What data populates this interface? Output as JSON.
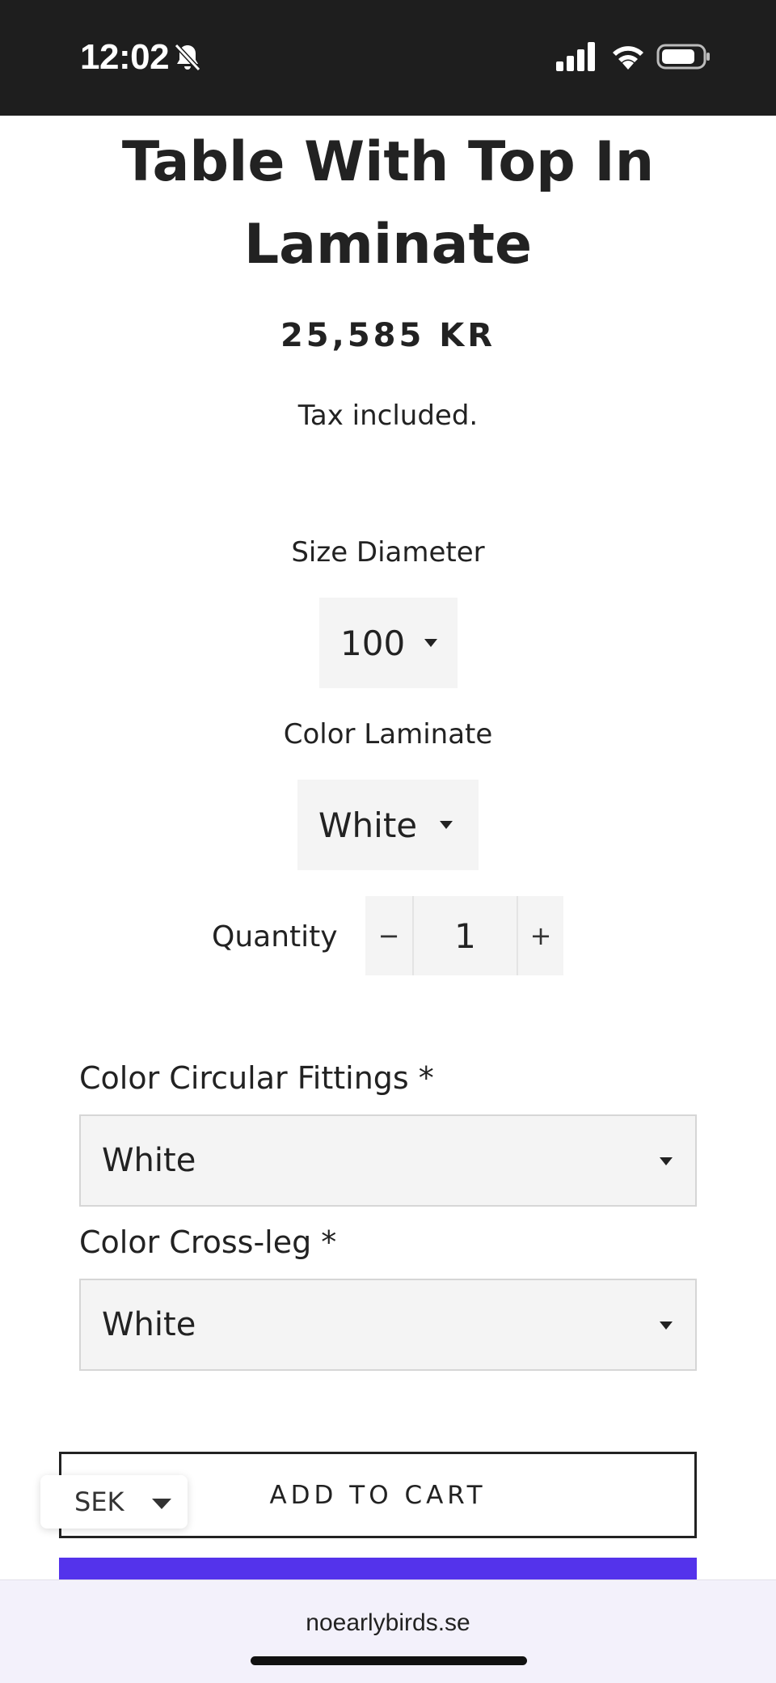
{
  "status_bar": {
    "time": "12:02",
    "icons": [
      "bell-slash-icon",
      "cellular-signal-icon",
      "wifi-icon",
      "battery-icon"
    ]
  },
  "product": {
    "title": "Table With Top In Laminate",
    "price": "25,585 KR",
    "tax_note": "Tax included."
  },
  "options": {
    "size": {
      "label": "Size Diameter",
      "value": "100"
    },
    "color_laminate": {
      "label": "Color Laminate",
      "value": "White"
    }
  },
  "quantity": {
    "label": "Quantity",
    "minus": "−",
    "value": "1",
    "plus": "+"
  },
  "custom_fields": {
    "fittings": {
      "label": "Color Circular Fittings *",
      "value": "White"
    },
    "crossleg": {
      "label": "Color Cross-leg *",
      "value": "White"
    }
  },
  "actions": {
    "add_to_cart": "ADD TO CART",
    "buy_now_color": "#5433eb"
  },
  "currency": {
    "code": "SEK"
  },
  "browser": {
    "url": "noearlybirds.se"
  }
}
